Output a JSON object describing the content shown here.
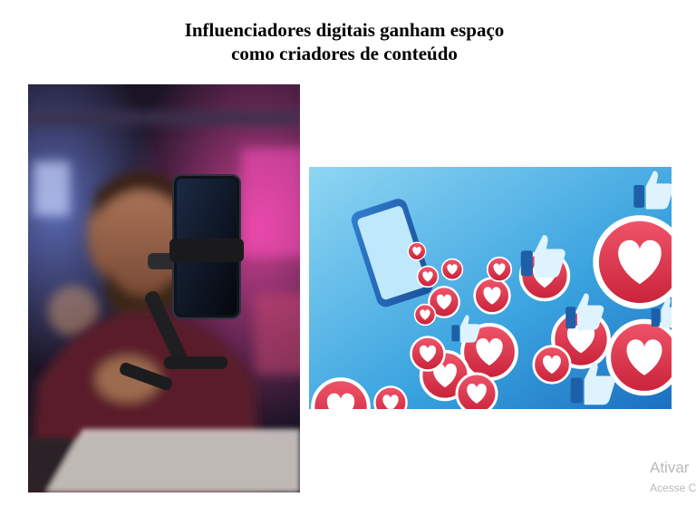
{
  "slide": {
    "title_line1": "Influenciadores digitais ganham espaço",
    "title_line2": "como criadores de conteúdo"
  },
  "images": {
    "left": "creator-recording-photo",
    "right": "social-media-likes-illustration"
  },
  "watermark": {
    "title": "Ativar",
    "subtitle": "Acesse C"
  },
  "colors": {
    "title": "#000000",
    "watermark": "#b9b9b9",
    "sky_blue": "#3fa7e0",
    "heart_red": "#e8354a"
  }
}
